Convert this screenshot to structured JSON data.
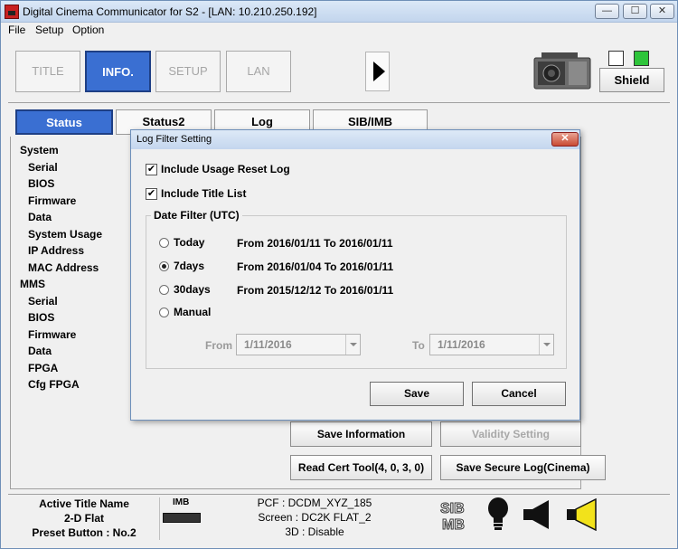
{
  "window": {
    "title": "Digital Cinema Communicator for S2 - [LAN: 10.210.250.192]",
    "min": "—",
    "max": "☐",
    "close": "✕"
  },
  "menu": [
    "File",
    "Setup",
    "Option"
  ],
  "main_tabs": [
    {
      "label": "TITLE",
      "active": false
    },
    {
      "label": "INFO.",
      "active": true
    },
    {
      "label": "SETUP",
      "active": false
    },
    {
      "label": "LAN",
      "active": false
    }
  ],
  "shield_label": "Shield",
  "indicator_colors": {
    "white": "#ffffff",
    "green": "#2ec43a"
  },
  "sub_tabs": [
    "Status",
    "Status2",
    "Log",
    "SIB/IMB"
  ],
  "tree": {
    "system_header": "System",
    "system_items": [
      "Serial",
      "BIOS",
      "Firmware",
      "Data",
      "System Usage",
      "IP Address",
      "MAC Address"
    ],
    "mms_header": "MMS",
    "mms_items": [
      "Serial",
      "BIOS",
      "Firmware",
      "Data",
      "FPGA",
      "Cfg FPGA"
    ]
  },
  "actions": {
    "save_information": "Save Information",
    "validity_setting": "Validity Setting",
    "read_cert_tool": "Read Cert Tool(4, 0, 3, 0)",
    "save_secure_log": "Save Secure Log(Cinema)"
  },
  "footer": {
    "active_title_label": "Active Title Name",
    "active_title_value": "2-D Flat",
    "preset_button": "Preset Button : No.2",
    "imb_label": "IMB",
    "pcf": "PCF : DCDM_XYZ_185",
    "screen": "Screen : DC2K FLAT_2",
    "three_d": "3D : Disable"
  },
  "dialog": {
    "title": "Log Filter Setting",
    "close": "✕",
    "include_usage_reset_log": {
      "label": "Include Usage Reset Log",
      "checked": true
    },
    "include_title_list": {
      "label": "Include Title List",
      "checked": true
    },
    "date_filter_title": "Date Filter (UTC)",
    "options": [
      {
        "label": "Today",
        "range": "From 2016/01/11 To 2016/01/11",
        "selected": false
      },
      {
        "label": "7days",
        "range": "From 2016/01/04 To 2016/01/11",
        "selected": true
      },
      {
        "label": "30days",
        "range": "From 2015/12/12 To 2016/01/11",
        "selected": false
      },
      {
        "label": "Manual",
        "range": "",
        "selected": false
      }
    ],
    "from_label": "From",
    "from_value": "1/11/2016",
    "to_label": "To",
    "to_value": "1/11/2016",
    "save_label": "Save",
    "cancel_label": "Cancel",
    "check_mark": "✔"
  }
}
